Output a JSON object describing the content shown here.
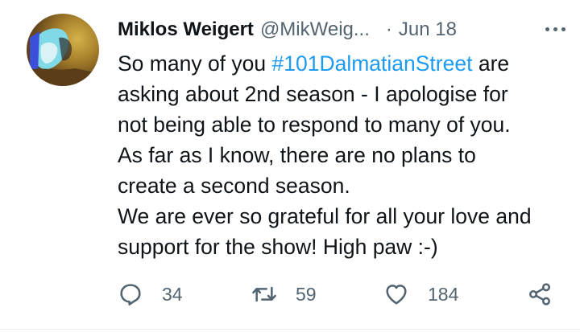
{
  "tweet": {
    "author_name": "Miklos Weigert",
    "author_handle": "@MikWeig...",
    "separator": "·",
    "date": "Jun 18",
    "more_label": "More",
    "lines": [
      {
        "before": "So many of you ",
        "hashtag": "#101DalmatianStreet",
        "after": " are"
      },
      {
        "text": "asking about 2nd season - I apologise for"
      },
      {
        "text": "not being able to respond to many of you."
      },
      {
        "text": "As far as I know, there are no plans to"
      },
      {
        "text": "create a second season."
      },
      {
        "text": "We are ever so grateful for all your love and"
      },
      {
        "text": "support for the show! High paw :-)"
      }
    ]
  },
  "actions": {
    "reply_count": "34",
    "retweet_count": "59",
    "like_count": "184",
    "icons": [
      "reply-icon",
      "retweet-icon",
      "like-icon",
      "share-icon"
    ]
  },
  "colors": {
    "hashtag": "#1d9bf0",
    "muted": "#536471",
    "text": "#0f1419"
  }
}
